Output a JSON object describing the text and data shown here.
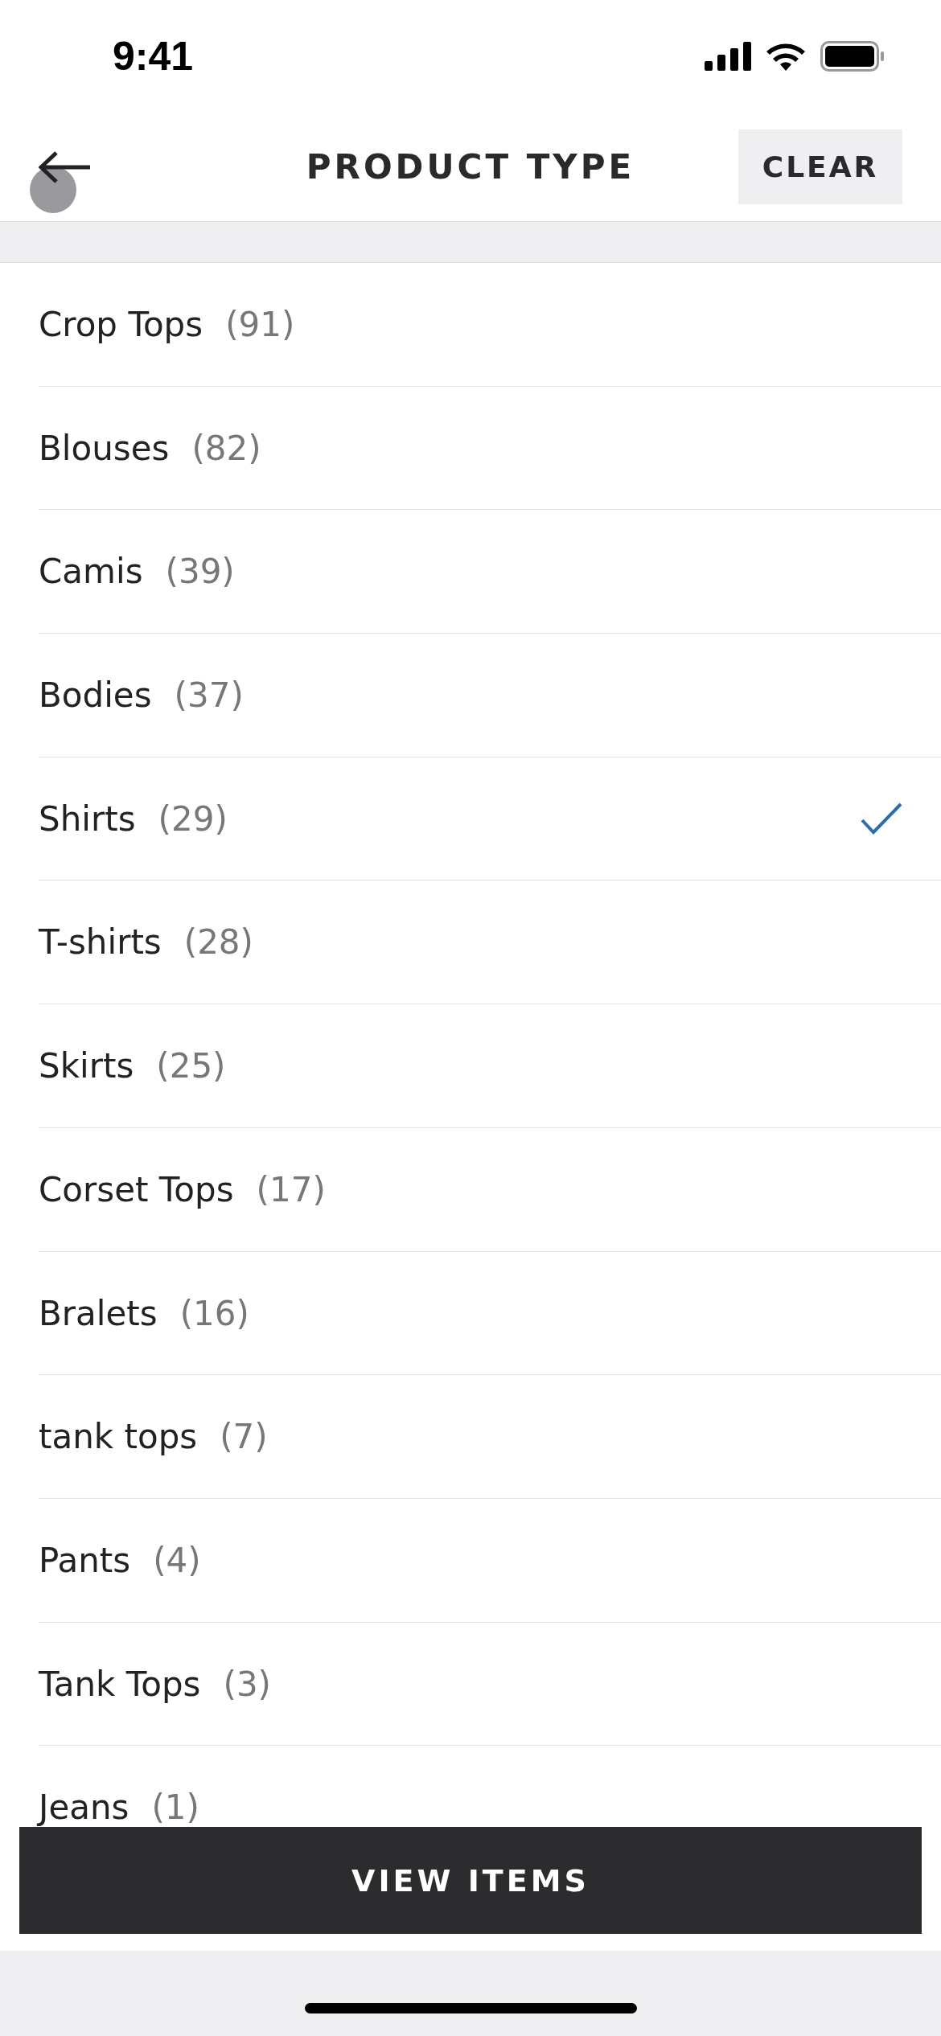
{
  "status_bar": {
    "time": "9:41"
  },
  "header": {
    "title": "PRODUCT TYPE",
    "clear_label": "CLEAR",
    "touch_indicator": true
  },
  "items": [
    {
      "name": "Crop Tops",
      "count": "(91)",
      "selected": false
    },
    {
      "name": "Blouses",
      "count": "(82)",
      "selected": false
    },
    {
      "name": "Camis",
      "count": "(39)",
      "selected": false
    },
    {
      "name": "Bodies",
      "count": "(37)",
      "selected": false
    },
    {
      "name": "Shirts",
      "count": "(29)",
      "selected": true
    },
    {
      "name": "T-shirts",
      "count": "(28)",
      "selected": false
    },
    {
      "name": "Skirts",
      "count": "(25)",
      "selected": false
    },
    {
      "name": "Corset Tops",
      "count": "(17)",
      "selected": false
    },
    {
      "name": "Bralets",
      "count": "(16)",
      "selected": false
    },
    {
      "name": "tank tops",
      "count": "(7)",
      "selected": false
    },
    {
      "name": "Pants",
      "count": "(4)",
      "selected": false
    },
    {
      "name": "Tank Tops",
      "count": "(3)",
      "selected": false
    },
    {
      "name": "Jeans",
      "count": "(1)",
      "selected": false
    }
  ],
  "view_button": {
    "label": "VIEW ITEMS"
  }
}
